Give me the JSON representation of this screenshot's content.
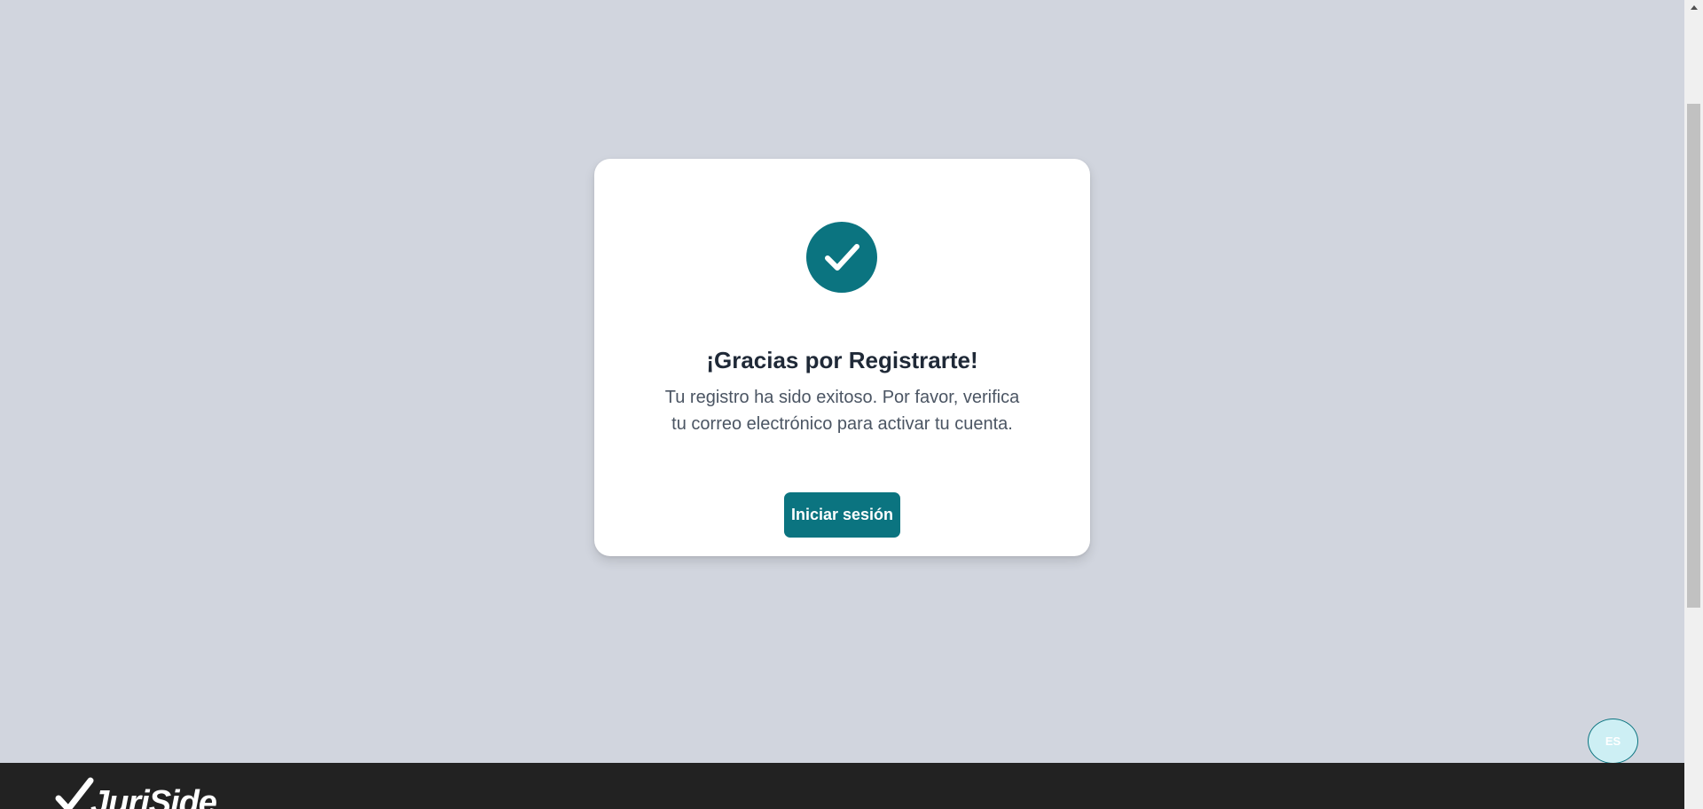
{
  "colors": {
    "background": "#d1d5de",
    "accent": "#0b7480",
    "footer": "#222222",
    "language_button_bg": "#cdeff4"
  },
  "success_card": {
    "icon": "check-circle-icon",
    "title": "¡Gracias por Registrarte!",
    "message_line1": "Tu registro ha sido exitoso. Por favor, verifica",
    "message_line2": "tu correo electrónico para activar tu cuenta.",
    "login_button_label": "Iniciar sesión"
  },
  "language_switcher": {
    "label": "ES"
  },
  "footer": {
    "logo_text": "JuriSide",
    "logo_icon": "checkmark-icon"
  }
}
